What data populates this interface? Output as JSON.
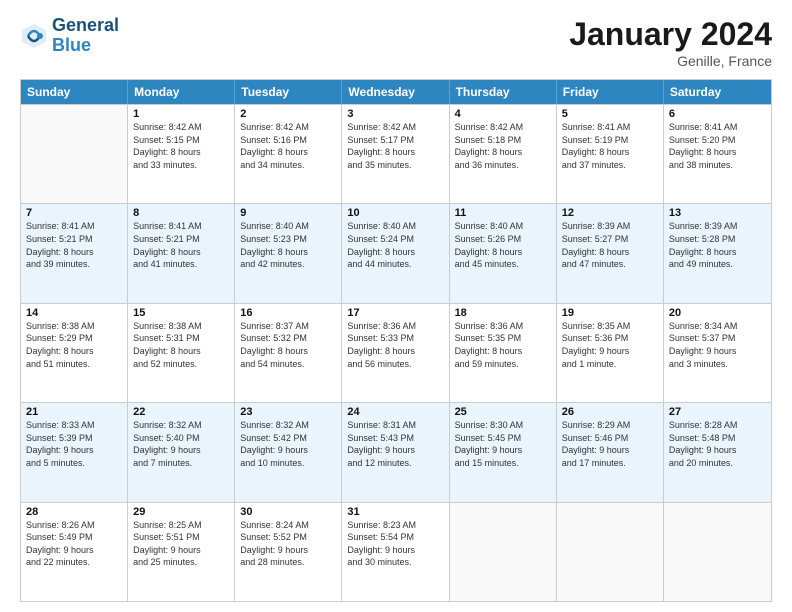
{
  "logo": {
    "line1": "General",
    "line2": "Blue"
  },
  "title": "January 2024",
  "subtitle": "Genille, France",
  "header_days": [
    "Sunday",
    "Monday",
    "Tuesday",
    "Wednesday",
    "Thursday",
    "Friday",
    "Saturday"
  ],
  "weeks": [
    [
      {
        "day": "",
        "sunrise": "",
        "sunset": "",
        "daylight": ""
      },
      {
        "day": "1",
        "sunrise": "Sunrise: 8:42 AM",
        "sunset": "Sunset: 5:15 PM",
        "daylight": "Daylight: 8 hours and 33 minutes."
      },
      {
        "day": "2",
        "sunrise": "Sunrise: 8:42 AM",
        "sunset": "Sunset: 5:16 PM",
        "daylight": "Daylight: 8 hours and 34 minutes."
      },
      {
        "day": "3",
        "sunrise": "Sunrise: 8:42 AM",
        "sunset": "Sunset: 5:17 PM",
        "daylight": "Daylight: 8 hours and 35 minutes."
      },
      {
        "day": "4",
        "sunrise": "Sunrise: 8:42 AM",
        "sunset": "Sunset: 5:18 PM",
        "daylight": "Daylight: 8 hours and 36 minutes."
      },
      {
        "day": "5",
        "sunrise": "Sunrise: 8:41 AM",
        "sunset": "Sunset: 5:19 PM",
        "daylight": "Daylight: 8 hours and 37 minutes."
      },
      {
        "day": "6",
        "sunrise": "Sunrise: 8:41 AM",
        "sunset": "Sunset: 5:20 PM",
        "daylight": "Daylight: 8 hours and 38 minutes."
      }
    ],
    [
      {
        "day": "7",
        "sunrise": "Sunrise: 8:41 AM",
        "sunset": "Sunset: 5:21 PM",
        "daylight": "Daylight: 8 hours and 39 minutes."
      },
      {
        "day": "8",
        "sunrise": "Sunrise: 8:41 AM",
        "sunset": "Sunset: 5:21 PM",
        "daylight": "Daylight: 8 hours and 41 minutes."
      },
      {
        "day": "9",
        "sunrise": "Sunrise: 8:40 AM",
        "sunset": "Sunset: 5:23 PM",
        "daylight": "Daylight: 8 hours and 42 minutes."
      },
      {
        "day": "10",
        "sunrise": "Sunrise: 8:40 AM",
        "sunset": "Sunset: 5:24 PM",
        "daylight": "Daylight: 8 hours and 44 minutes."
      },
      {
        "day": "11",
        "sunrise": "Sunrise: 8:40 AM",
        "sunset": "Sunset: 5:26 PM",
        "daylight": "Daylight: 8 hours and 45 minutes."
      },
      {
        "day": "12",
        "sunrise": "Sunrise: 8:39 AM",
        "sunset": "Sunset: 5:27 PM",
        "daylight": "Daylight: 8 hours and 47 minutes."
      },
      {
        "day": "13",
        "sunrise": "Sunrise: 8:39 AM",
        "sunset": "Sunset: 5:28 PM",
        "daylight": "Daylight: 8 hours and 49 minutes."
      }
    ],
    [
      {
        "day": "14",
        "sunrise": "Sunrise: 8:38 AM",
        "sunset": "Sunset: 5:29 PM",
        "daylight": "Daylight: 8 hours and 51 minutes."
      },
      {
        "day": "15",
        "sunrise": "Sunrise: 8:38 AM",
        "sunset": "Sunset: 5:31 PM",
        "daylight": "Daylight: 8 hours and 52 minutes."
      },
      {
        "day": "16",
        "sunrise": "Sunrise: 8:37 AM",
        "sunset": "Sunset: 5:32 PM",
        "daylight": "Daylight: 8 hours and 54 minutes."
      },
      {
        "day": "17",
        "sunrise": "Sunrise: 8:36 AM",
        "sunset": "Sunset: 5:33 PM",
        "daylight": "Daylight: 8 hours and 56 minutes."
      },
      {
        "day": "18",
        "sunrise": "Sunrise: 8:36 AM",
        "sunset": "Sunset: 5:35 PM",
        "daylight": "Daylight: 8 hours and 59 minutes."
      },
      {
        "day": "19",
        "sunrise": "Sunrise: 8:35 AM",
        "sunset": "Sunset: 5:36 PM",
        "daylight": "Daylight: 9 hours and 1 minute."
      },
      {
        "day": "20",
        "sunrise": "Sunrise: 8:34 AM",
        "sunset": "Sunset: 5:37 PM",
        "daylight": "Daylight: 9 hours and 3 minutes."
      }
    ],
    [
      {
        "day": "21",
        "sunrise": "Sunrise: 8:33 AM",
        "sunset": "Sunset: 5:39 PM",
        "daylight": "Daylight: 9 hours and 5 minutes."
      },
      {
        "day": "22",
        "sunrise": "Sunrise: 8:32 AM",
        "sunset": "Sunset: 5:40 PM",
        "daylight": "Daylight: 9 hours and 7 minutes."
      },
      {
        "day": "23",
        "sunrise": "Sunrise: 8:32 AM",
        "sunset": "Sunset: 5:42 PM",
        "daylight": "Daylight: 9 hours and 10 minutes."
      },
      {
        "day": "24",
        "sunrise": "Sunrise: 8:31 AM",
        "sunset": "Sunset: 5:43 PM",
        "daylight": "Daylight: 9 hours and 12 minutes."
      },
      {
        "day": "25",
        "sunrise": "Sunrise: 8:30 AM",
        "sunset": "Sunset: 5:45 PM",
        "daylight": "Daylight: 9 hours and 15 minutes."
      },
      {
        "day": "26",
        "sunrise": "Sunrise: 8:29 AM",
        "sunset": "Sunset: 5:46 PM",
        "daylight": "Daylight: 9 hours and 17 minutes."
      },
      {
        "day": "27",
        "sunrise": "Sunrise: 8:28 AM",
        "sunset": "Sunset: 5:48 PM",
        "daylight": "Daylight: 9 hours and 20 minutes."
      }
    ],
    [
      {
        "day": "28",
        "sunrise": "Sunrise: 8:26 AM",
        "sunset": "Sunset: 5:49 PM",
        "daylight": "Daylight: 9 hours and 22 minutes."
      },
      {
        "day": "29",
        "sunrise": "Sunrise: 8:25 AM",
        "sunset": "Sunset: 5:51 PM",
        "daylight": "Daylight: 9 hours and 25 minutes."
      },
      {
        "day": "30",
        "sunrise": "Sunrise: 8:24 AM",
        "sunset": "Sunset: 5:52 PM",
        "daylight": "Daylight: 9 hours and 28 minutes."
      },
      {
        "day": "31",
        "sunrise": "Sunrise: 8:23 AM",
        "sunset": "Sunset: 5:54 PM",
        "daylight": "Daylight: 9 hours and 30 minutes."
      },
      {
        "day": "",
        "sunrise": "",
        "sunset": "",
        "daylight": ""
      },
      {
        "day": "",
        "sunrise": "",
        "sunset": "",
        "daylight": ""
      },
      {
        "day": "",
        "sunrise": "",
        "sunset": "",
        "daylight": ""
      }
    ]
  ]
}
